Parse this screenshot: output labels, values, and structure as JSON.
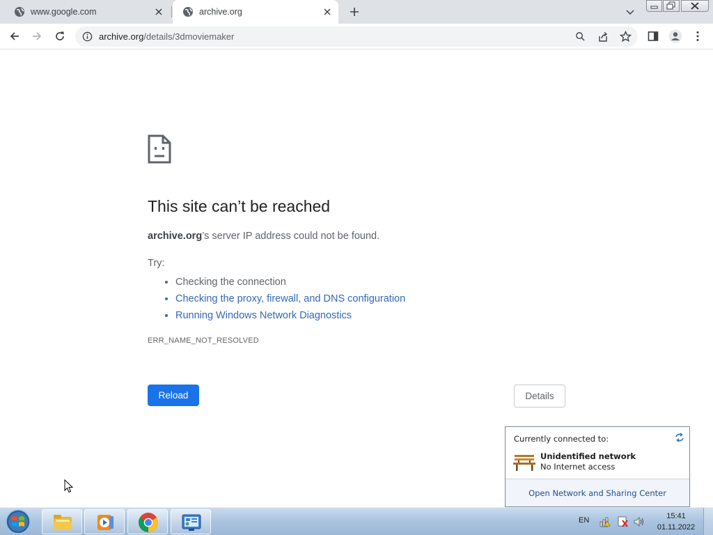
{
  "tabs": [
    {
      "title": "www.google.com",
      "active": false
    },
    {
      "title": "archive.org",
      "active": true
    }
  ],
  "toolbar": {
    "url_domain": "archive.org",
    "url_path": "/details/3dmoviemaker"
  },
  "error_page": {
    "title": "This site can’t be reached",
    "host": "archive.org",
    "description_rest": "’s server IP address could not be found.",
    "try_label": "Try:",
    "suggestions": [
      {
        "text": "Checking the connection",
        "link": false
      },
      {
        "text": "Checking the proxy, firewall, and DNS configuration",
        "link": true
      },
      {
        "text": "Running Windows Network Diagnostics",
        "link": true
      }
    ],
    "error_code": "ERR_NAME_NOT_RESOLVED",
    "reload_label": "Reload",
    "details_label": "Details"
  },
  "network_flyout": {
    "header": "Currently connected to:",
    "network_name": "Unidentified network",
    "network_status": "No Internet access",
    "footer_link": "Open Network and Sharing Center"
  },
  "taskbar": {
    "language": "EN",
    "time": "15:41",
    "date": "01.11.2022",
    "pinned": [
      "file-explorer-icon",
      "media-player-icon",
      "chrome-icon",
      "control-panel-icon"
    ]
  },
  "colors": {
    "accent": "#1a73e8",
    "link": "#3367b8",
    "tabstrip": "#dee1e6",
    "taskbar": "#a9c3df"
  }
}
